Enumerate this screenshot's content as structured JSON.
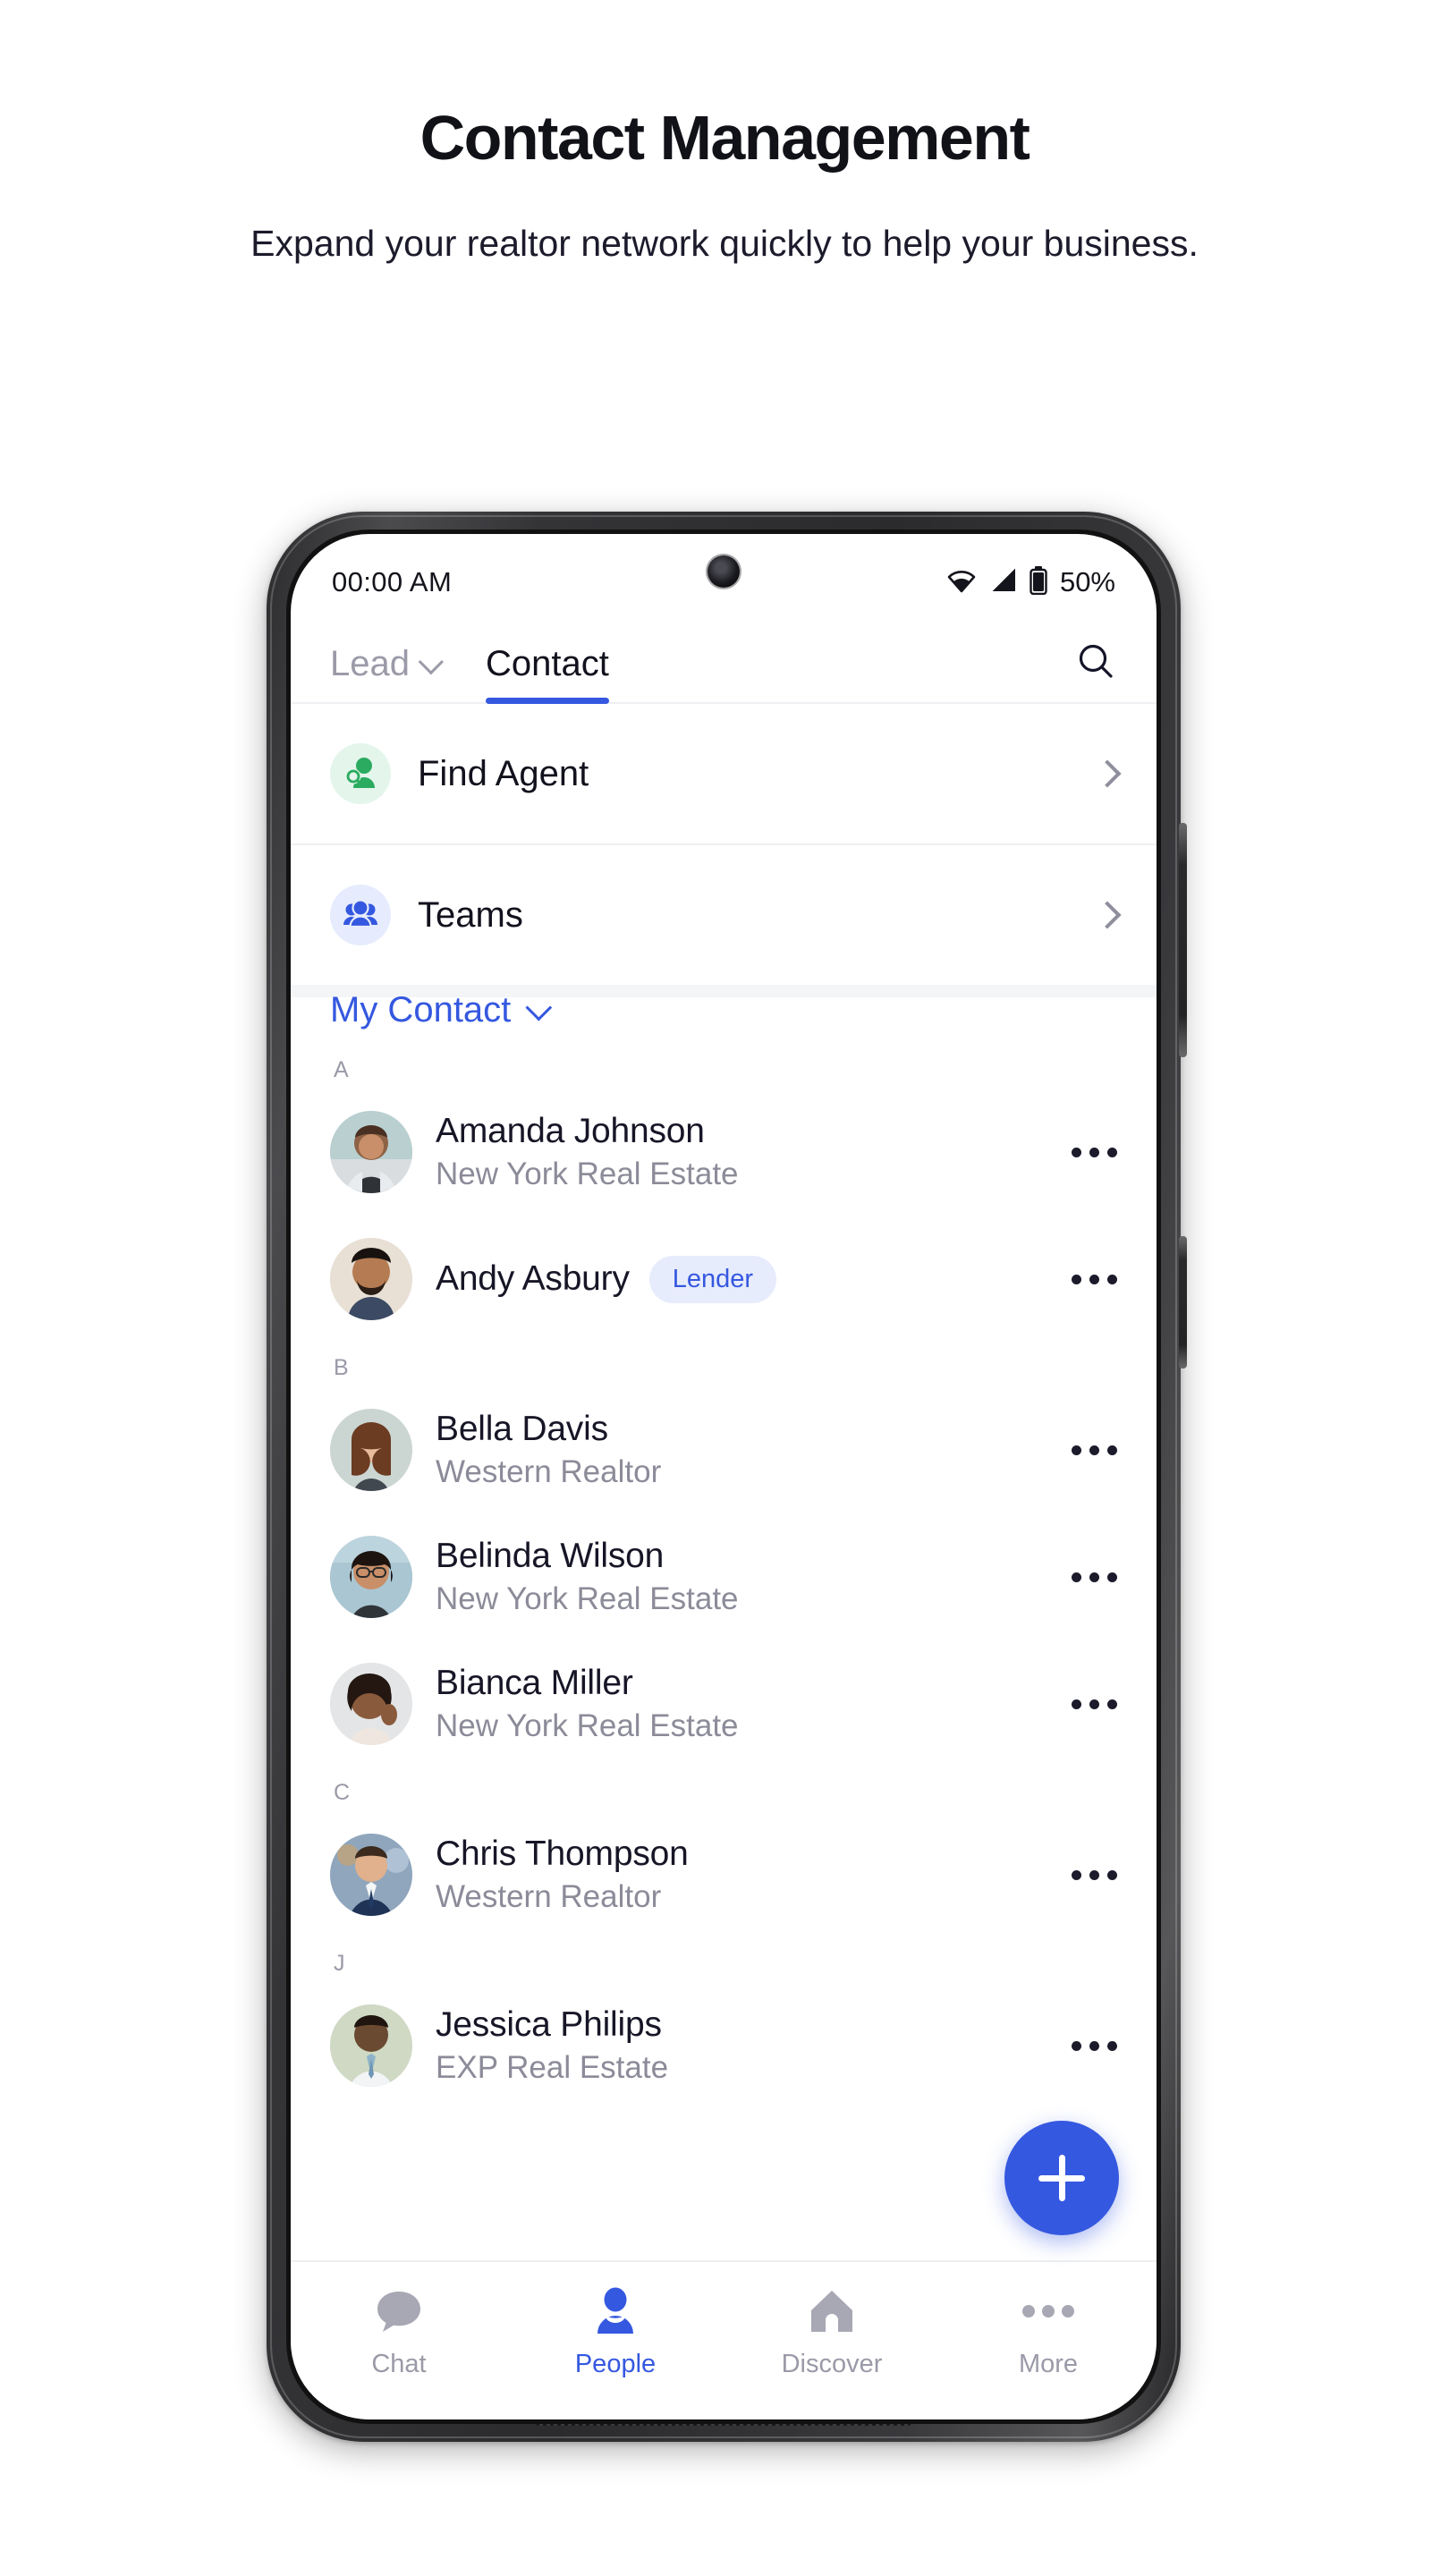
{
  "header": {
    "title": "Contact Management",
    "subtitle": "Expand your realtor network quickly to help your business."
  },
  "colors": {
    "accent_blue": "#3558e0",
    "badge_bg": "#e7ecfd",
    "green_icon": "#2aab5f",
    "green_bg": "#e4f6ec",
    "blue_bg": "#e6ecfd",
    "text_primary": "#161627",
    "text_muted": "#8b8b99"
  },
  "status_bar": {
    "time": "00:00 AM",
    "battery_percent": "50%",
    "wifi_icon": "wifi-icon",
    "signal_icon": "signal-icon",
    "battery_icon": "battery-icon"
  },
  "top_tabs": {
    "lead_label": "Lead",
    "lead_chevron_icon": "chevron-down-icon",
    "contact_label": "Contact",
    "active_tab": "Contact",
    "search_icon": "search-icon"
  },
  "entries": [
    {
      "label": "Find Agent",
      "icon": "person-search-icon",
      "chevron": "chevron-right-icon",
      "tone": "green"
    },
    {
      "label": "Teams",
      "icon": "people-group-icon",
      "chevron": "chevron-right-icon",
      "tone": "blue"
    }
  ],
  "my_contact": {
    "label": "My Contact",
    "chevron_icon": "chevron-down-icon"
  },
  "contact_sections": [
    {
      "letter": "A",
      "contacts": [
        {
          "name": "Amanda Johnson",
          "company": "New York Real Estate",
          "badge": "",
          "menu_icon": "more-dots-icon"
        },
        {
          "name": "Andy Asbury",
          "company": "",
          "badge": "Lender",
          "menu_icon": "more-dots-icon"
        }
      ]
    },
    {
      "letter": "B",
      "contacts": [
        {
          "name": "Bella Davis",
          "company": "Western Realtor",
          "badge": "",
          "menu_icon": "more-dots-icon"
        },
        {
          "name": "Belinda Wilson",
          "company": "New York Real Estate",
          "badge": "",
          "menu_icon": "more-dots-icon"
        },
        {
          "name": "Bianca Miller",
          "company": "New York Real Estate",
          "badge": "",
          "menu_icon": "more-dots-icon"
        }
      ]
    },
    {
      "letter": "C",
      "contacts": [
        {
          "name": "Chris Thompson",
          "company": "Western Realtor",
          "badge": "",
          "menu_icon": "more-dots-icon"
        }
      ]
    },
    {
      "letter": "J",
      "contacts": [
        {
          "name": "Jessica Philips",
          "company": "EXP Real Estate",
          "badge": "",
          "menu_icon": "more-dots-icon"
        }
      ]
    }
  ],
  "fab": {
    "icon": "plus-icon",
    "label": ""
  },
  "bottom_nav": {
    "active": "People",
    "items": [
      {
        "label": "Chat",
        "icon": "chat-bubble-icon"
      },
      {
        "label": "People",
        "icon": "person-icon"
      },
      {
        "label": "Discover",
        "icon": "home-icon"
      },
      {
        "label": "More",
        "icon": "more-dots-icon"
      }
    ]
  }
}
